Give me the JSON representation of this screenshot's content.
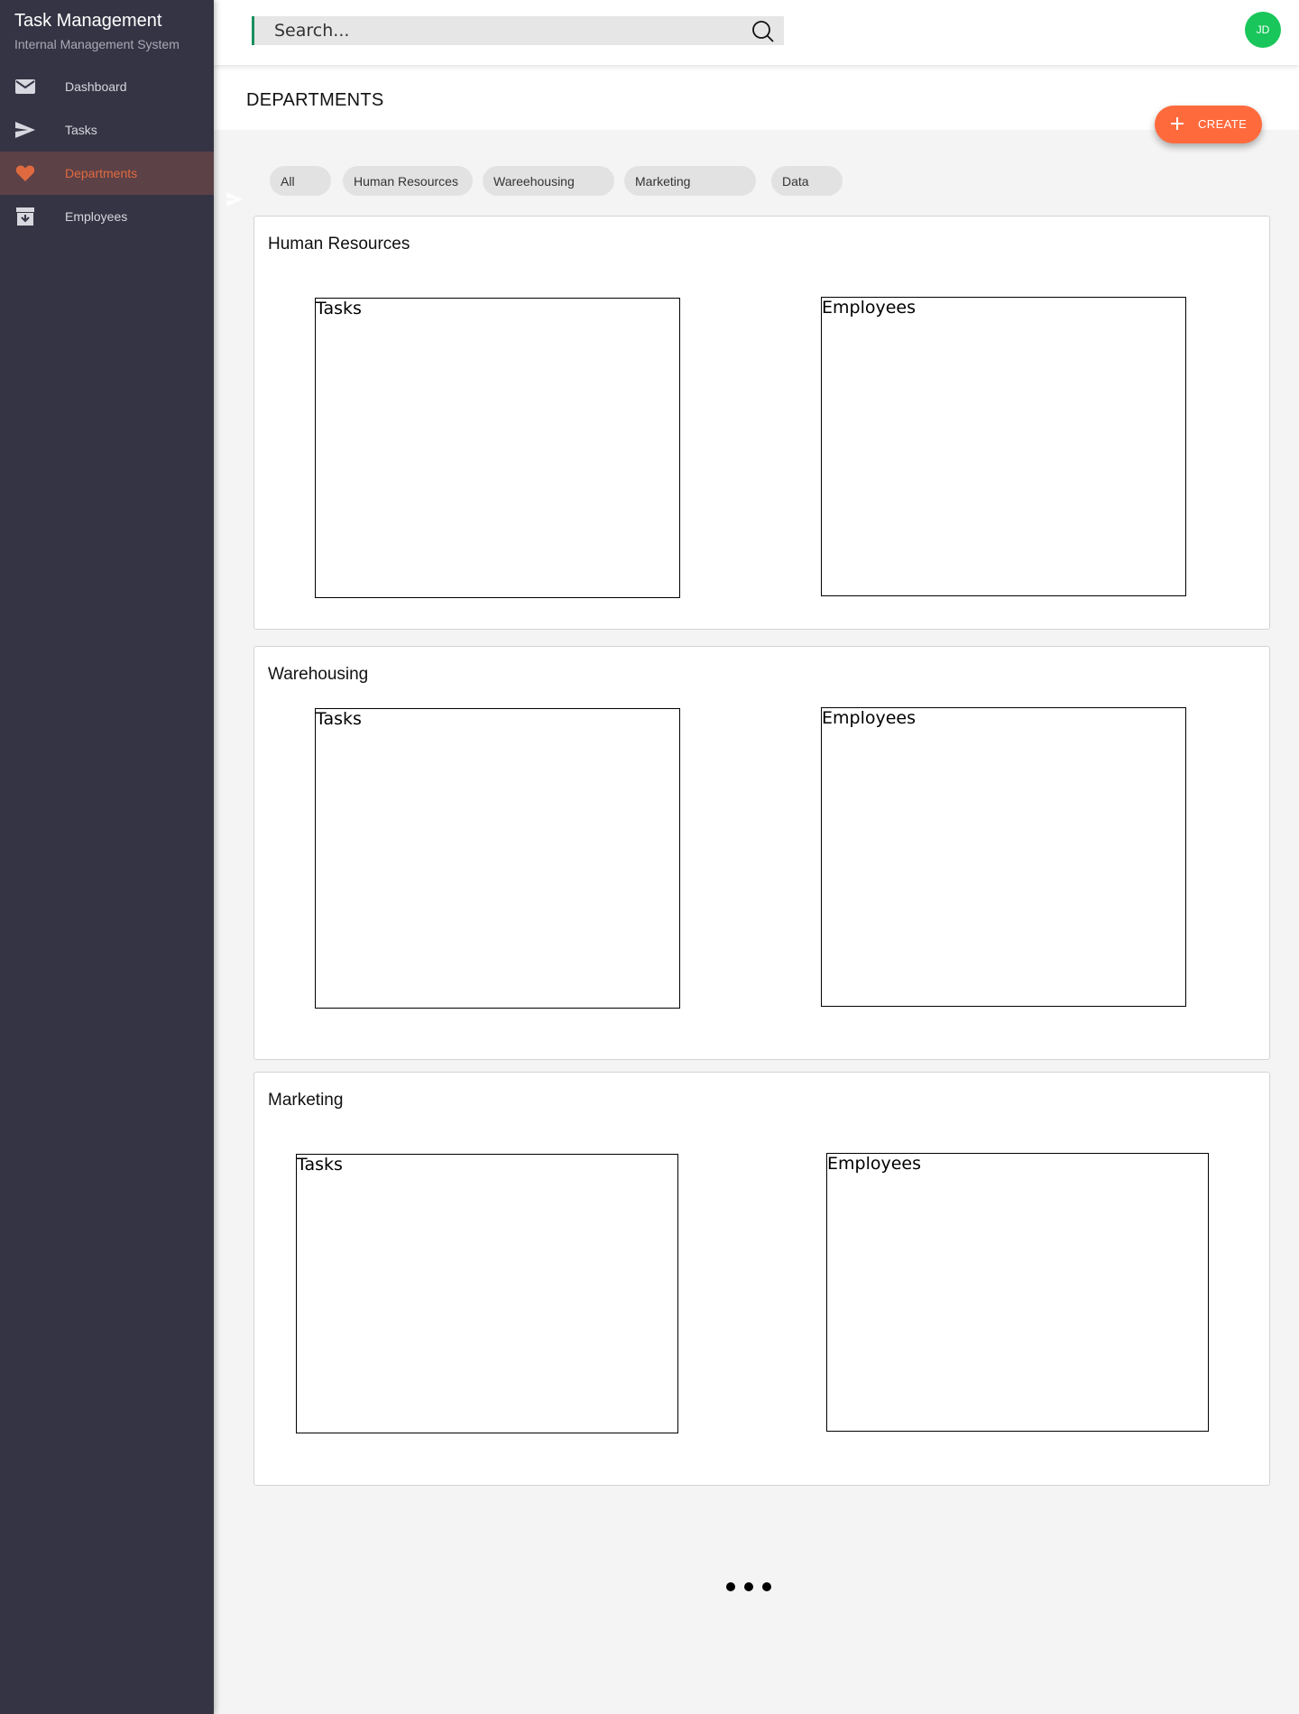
{
  "app": {
    "title": "Task Management",
    "subtitle": "Internal Management System"
  },
  "sidebar": {
    "items": [
      {
        "label": "Dashboard",
        "icon": "mail-icon",
        "active": false
      },
      {
        "label": "Tasks",
        "icon": "send-icon",
        "active": false
      },
      {
        "label": "Departments",
        "icon": "heart-icon",
        "active": true
      },
      {
        "label": "Employees",
        "icon": "archive-icon",
        "active": false
      }
    ]
  },
  "search": {
    "placeholder": "Search...",
    "value": ""
  },
  "user": {
    "initials": "JD",
    "avatar_color": "#19c65b"
  },
  "header": {
    "title": "DEPARTMENTS",
    "create_label": "CREATE"
  },
  "filters": [
    "All",
    "Human Resources",
    "Wareehousing",
    "Marketing",
    "Data"
  ],
  "departments": [
    {
      "name": "Human Resources",
      "tasks_label": "Tasks",
      "employees_label": "Employees"
    },
    {
      "name": "Warehousing",
      "tasks_label": "Tasks",
      "employees_label": "Employees"
    },
    {
      "name": "Marketing",
      "tasks_label": "Tasks",
      "employees_label": "Employees"
    }
  ],
  "colors": {
    "sidebar_bg": "#343444",
    "accent": "#ff6a3d",
    "active_label": "#e06a3f",
    "avatar": "#19c65b"
  }
}
